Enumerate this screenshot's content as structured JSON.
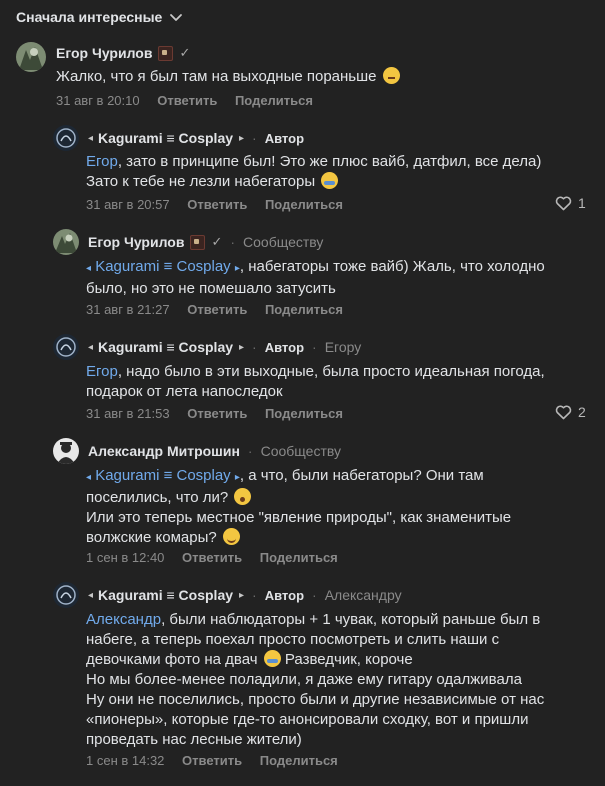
{
  "sort": {
    "label": "Сначала интересные"
  },
  "comments": [
    {
      "name": "Егор Чурилов",
      "text": [
        "Жалко, что я был там на выходные пораньше"
      ],
      "time": "31 авг в 20:10",
      "reply": "Ответить",
      "share": "Поделиться"
    },
    {
      "name": "Kagurami ≡ Cosplay",
      "role": "Автор",
      "mention": "Егор",
      "text": [
        ", зато в принципе был! Это же плюс вайб, датфил, все дела)",
        "Зато к тебе не лезли набегаторы"
      ],
      "time": "31 авг в 20:57",
      "reply": "Ответить",
      "share": "Поделиться",
      "likes": "1"
    },
    {
      "name": "Егор Чурилов",
      "to": "Сообществу",
      "mention": "Kagurami ≡ Cosplay",
      "text": [
        ", набегаторы тоже вайб) Жаль, что холодно",
        "было, но это не помешало затусить"
      ],
      "time": "31 авг в 21:27",
      "reply": "Ответить",
      "share": "Поделиться"
    },
    {
      "name": "Kagurami ≡ Cosplay",
      "role": "Автор",
      "to": "Егору",
      "mention": "Егор",
      "text": [
        ", надо было в эти выходные, была просто идеальная погода,",
        "подарок от лета напоследок"
      ],
      "time": "31 авг в 21:53",
      "reply": "Ответить",
      "share": "Поделиться",
      "likes": "2"
    },
    {
      "name": "Александр Митрошин",
      "to": "Сообществу",
      "mention": "Kagurami ≡ Cosplay",
      "text": [
        ", а что, были набегаторы? Они там",
        "поселились, что ли?",
        "Или это теперь местное \"явление природы\", как знаменитые",
        "волжские комары?"
      ],
      "time": "1 сен в 12:40",
      "reply": "Ответить",
      "share": "Поделиться"
    },
    {
      "name": "Kagurami ≡ Cosplay",
      "role": "Автор",
      "to": "Александру",
      "mention": "Александр",
      "text": [
        ", были наблюдаторы + 1 чувак, который раньше был в",
        "набеге, а теперь поехал просто посмотреть и слить наши с",
        "девочками фото на двач",
        " Разведчик, короче",
        "Но мы более-менее поладили, я даже ему гитару одалживала",
        "Ну они не поселились, просто были и другие независимые от нас",
        "«пионеры», которые где-то анонсировали сходку, вот и пришли",
        "проведать нас лесные жители)"
      ],
      "time": "1 сен в 14:32",
      "reply": "Ответить",
      "share": "Поделиться"
    }
  ]
}
